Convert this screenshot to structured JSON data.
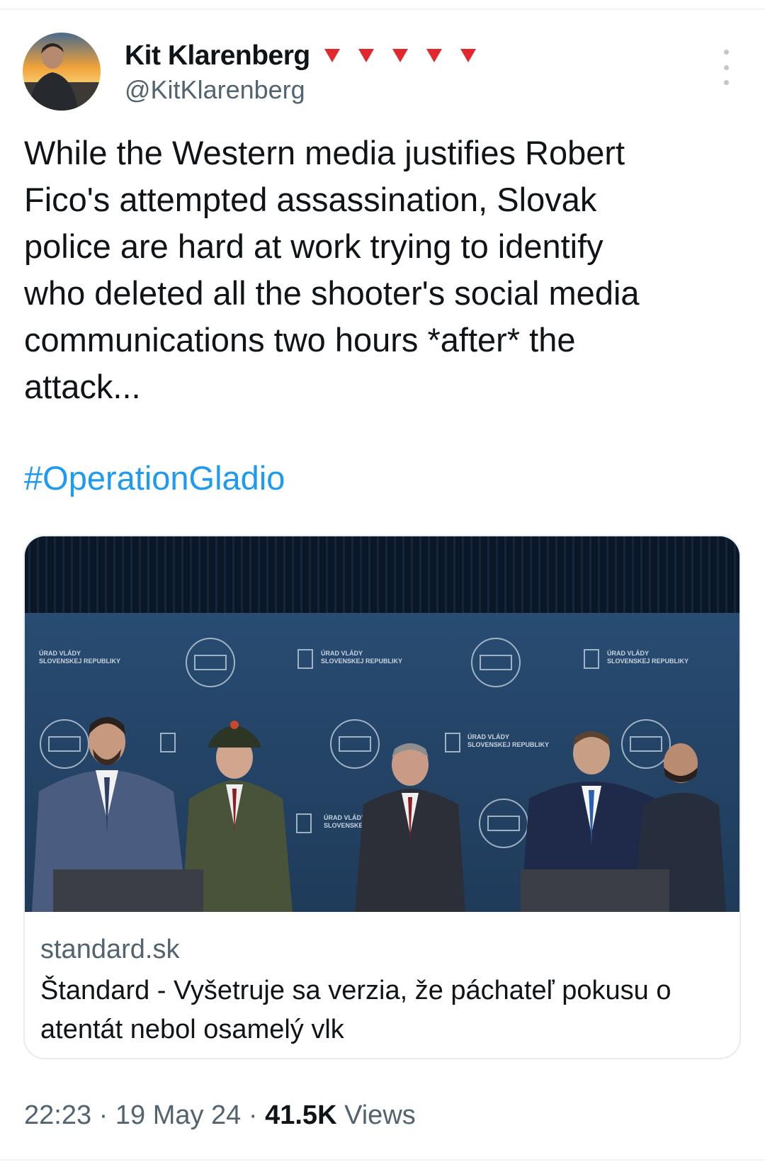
{
  "author": {
    "display_name": "Kit Klarenberg",
    "handle": "@KitKlarenberg",
    "flag_icons": [
      "red-triangle-icon",
      "red-triangle-icon",
      "red-triangle-icon",
      "red-triangle-icon",
      "red-triangle-icon"
    ],
    "flag_color": "#e0282e"
  },
  "tweet": {
    "text": "While the Western media justifies Robert\nFico's attempted assassination, Slovak\npolice are hard at work trying to identify\nwho deleted all the shooter's social media\ncommunications two hours *after* the\nattack...",
    "hashtag": "#OperationGladio",
    "hashtag_color": "#1d9bf0"
  },
  "link_card": {
    "domain": "standard.sk",
    "title": "Štandard - Vyšetruje sa verzia, že páchateľ pokusu o atentát nebol osamelý vlk",
    "backdrop_text": "ÚRAD VLÁDY SLOVENSKEJ REPUBLIKY"
  },
  "meta": {
    "time": "22:23",
    "separator": " · ",
    "date": "19 May 24",
    "views_count": "41.5K",
    "views_label": "Views"
  },
  "icons": {
    "more": "more-vertical-icon",
    "avatar": "avatar-photo"
  }
}
